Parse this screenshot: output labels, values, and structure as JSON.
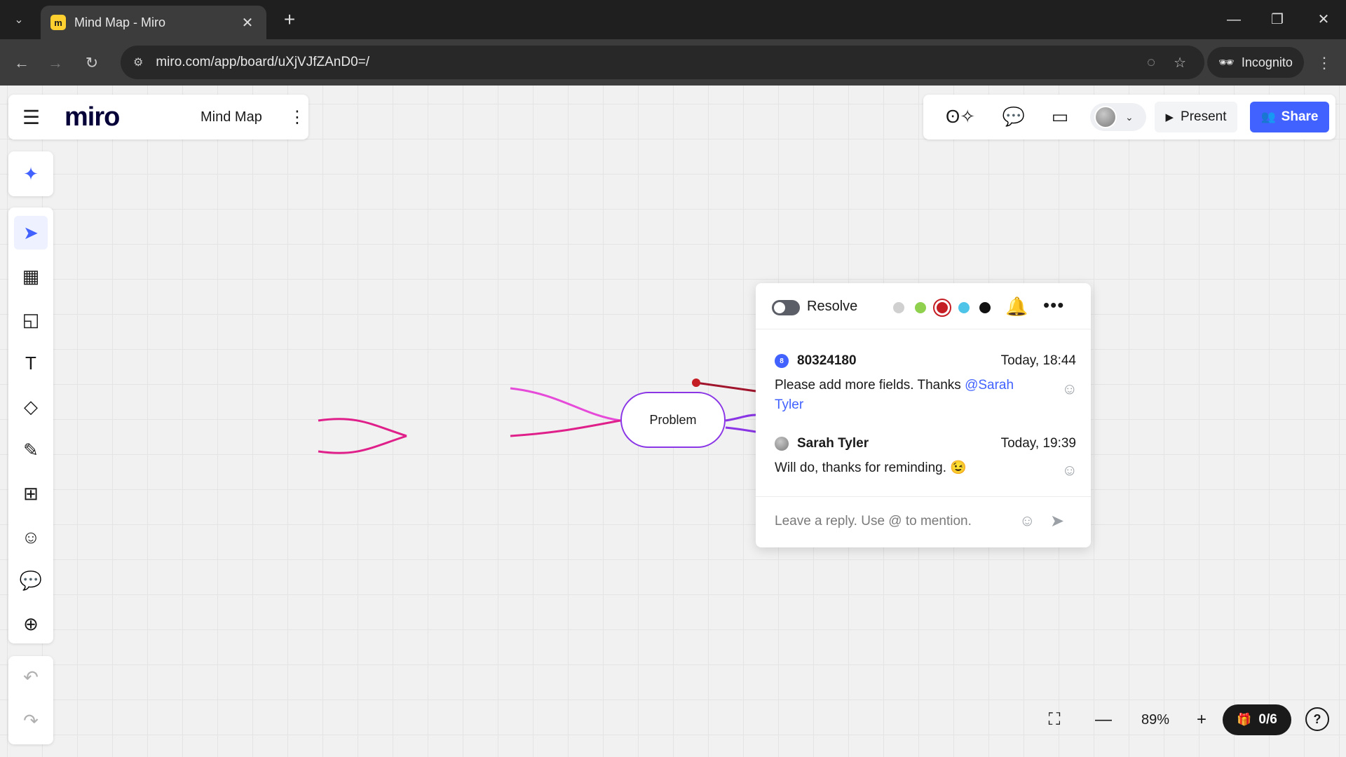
{
  "browser": {
    "tab_title": "Mind Map - Miro",
    "favicon_letter": "m",
    "url": "miro.com/app/board/uXjVJfZAnD0=/",
    "incognito_label": "Incognito"
  },
  "board": {
    "logo": "miro",
    "name": "Mind Map"
  },
  "header_actions": {
    "present_label": "Present",
    "share_label": "Share"
  },
  "mindmap": {
    "node_label": "Problem"
  },
  "comment": {
    "resolve_label": "Resolve",
    "colors": [
      "#d0d0d0",
      "#8fd14f",
      "#c41e24",
      "#4ec5e8",
      "#111111"
    ],
    "selected_color": "#c41e24",
    "messages": [
      {
        "author": "80324180",
        "avatar_letter": "8",
        "time": "Today, 18:44",
        "text": "Please add more fields. Thanks ",
        "mention": "@Sarah Tyler"
      },
      {
        "author": "Sarah Tyler",
        "time": "Today, 19:39",
        "text": "Will do, thanks for reminding. 😉"
      }
    ],
    "reply_placeholder": "Leave a reply. Use @ to mention."
  },
  "bottom": {
    "zoom": "89%",
    "counter": "0/6"
  }
}
